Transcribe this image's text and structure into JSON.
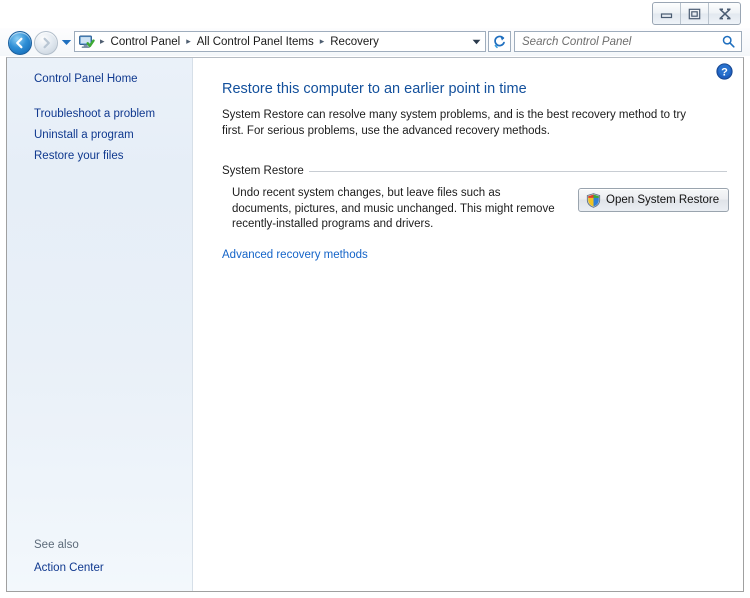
{
  "window": {
    "controls": [
      {
        "name": "minimize",
        "label": "Minimize"
      },
      {
        "name": "maximize",
        "label": "Maximize"
      },
      {
        "name": "close",
        "label": "Close"
      }
    ]
  },
  "navbar": {
    "back_label": "Back",
    "forward_label": "Forward",
    "recent_pages_label": "Recent pages",
    "breadcrumbs": [
      {
        "label": "Control Panel"
      },
      {
        "label": "All Control Panel Items"
      },
      {
        "label": "Recovery"
      }
    ],
    "breadcrumb_separator": "▸",
    "dropdown_label": "Previous locations",
    "refresh_label": "Refresh",
    "address_icon": "control-panel-icon"
  },
  "search": {
    "placeholder": "Search Control Panel",
    "value": "",
    "icon": "search-icon"
  },
  "sidebar": {
    "items": [
      {
        "label": "Control Panel Home"
      },
      {
        "label": "Troubleshoot a problem"
      },
      {
        "label": "Uninstall a program"
      },
      {
        "label": "Restore your files"
      }
    ],
    "see_also_label": "See also",
    "see_also_items": [
      {
        "label": "Action Center"
      }
    ]
  },
  "content": {
    "help_label": "Help",
    "title": "Restore this computer to an earlier point in time",
    "intro": "System Restore can resolve many system problems, and is the best recovery method to try first. For serious problems, use the advanced recovery methods.",
    "group": {
      "header": "System Restore",
      "description": "Undo recent system changes, but leave files such as documents, pictures, and music unchanged. This might remove recently-installed programs and drivers.",
      "button_label": "Open System Restore",
      "button_icon": "uac-shield-icon"
    },
    "advanced_link": "Advanced recovery methods"
  },
  "colors": {
    "accent_blue": "#13509c",
    "link_blue": "#1464c8",
    "sidebar_link": "#10398f",
    "sidebar_bg": "#e9f0f8"
  }
}
